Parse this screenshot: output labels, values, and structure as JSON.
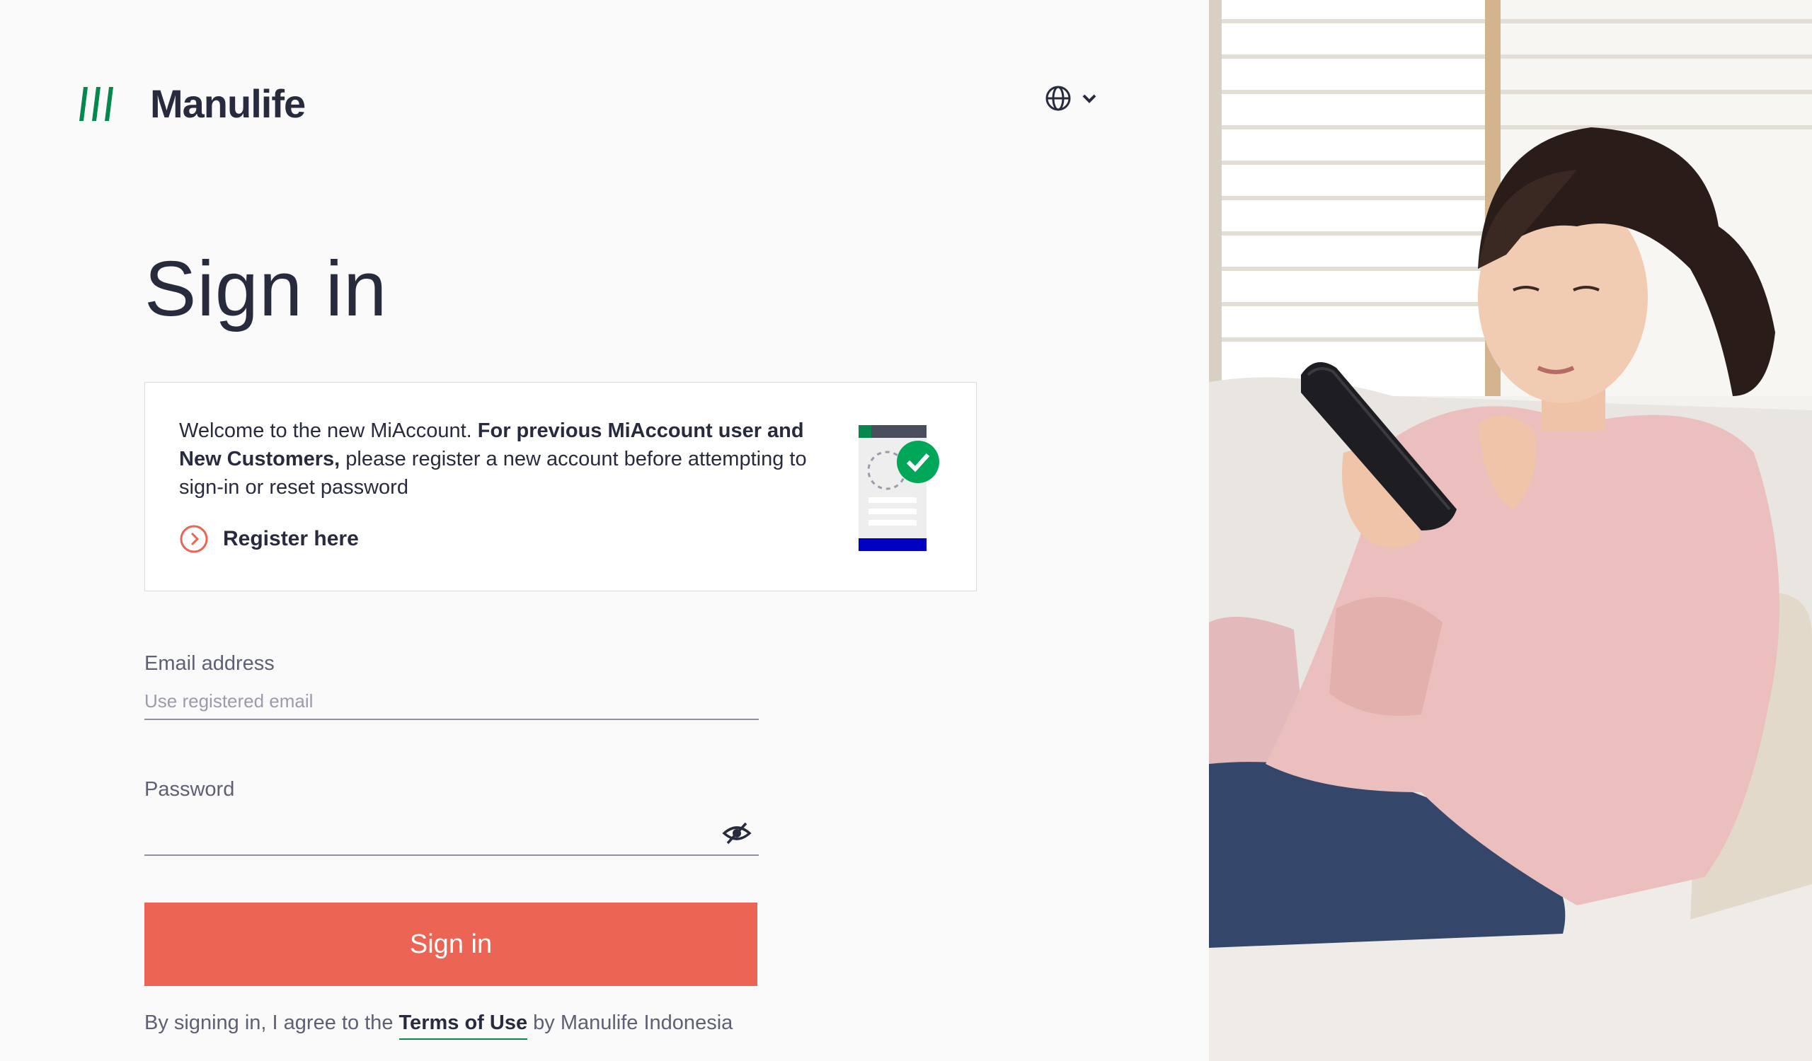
{
  "brand": {
    "name": "Manulife",
    "accent_green": "#06874e",
    "accent_coral": "#ec6453"
  },
  "header": {
    "language_icon": "globe-icon",
    "language_caret": "chevron-down-icon"
  },
  "main": {
    "title": "Sign in",
    "info_card": {
      "text_intro": "Welcome to the new MiAccount. ",
      "text_bold": "For previous MiAccount user and New Customers,",
      "text_rest": " please register a new account before attempting to sign-in or reset password",
      "register_label": "Register here",
      "register_icon": "chevron-right-circle-icon"
    },
    "email": {
      "label": "Email address",
      "placeholder": "Use registered email",
      "value": ""
    },
    "password": {
      "label": "Password",
      "value": "",
      "toggle_icon": "eye-slash-icon"
    },
    "submit_label": "Sign in",
    "terms": {
      "prefix": "By signing in, I agree to the ",
      "link": "Terms of Use",
      "suffix": " by Manulife Indonesia"
    }
  }
}
